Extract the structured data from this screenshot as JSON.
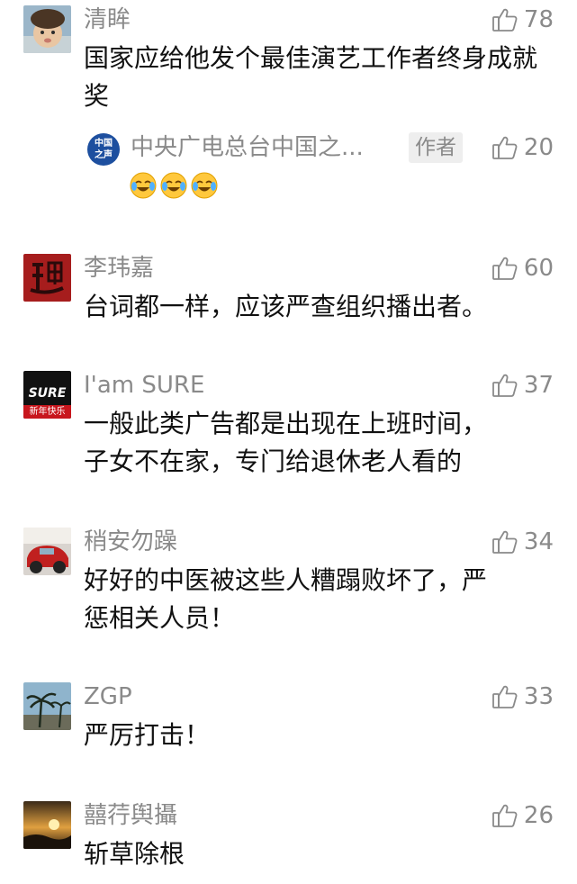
{
  "comments": [
    {
      "nickname": "清眸",
      "likes": "78",
      "text": "国家应给他发个最佳演艺工作者终身成就奖",
      "reply": {
        "avatar_text": "中国\n之声",
        "name": "中央广电总台中国之...",
        "author_tag": "作者",
        "likes": "20",
        "emoji_icon": "laughing-crying-emoji",
        "emoji_count": 3
      }
    },
    {
      "nickname": "李玮嘉",
      "likes": "60",
      "text": "台词都一样，应该严查组织播出者。"
    },
    {
      "nickname": "I'am SURE",
      "likes": "37",
      "text": "一般此类广告都是出现在上班时间，\n子女不在家，专门给退休老人看的",
      "avatar_text": "SURE",
      "avatar_subtext": "新年快乐"
    },
    {
      "nickname": "稍安勿躁",
      "likes": "34",
      "text": "好好的中医被这些人糟蹋败坏了，严\n惩相关人员！"
    },
    {
      "nickname": "ZGP",
      "likes": "33",
      "text": "严厉打击！"
    },
    {
      "nickname": "囍荇舆攝",
      "likes": "26",
      "text": "斩草除根"
    }
  ],
  "icons": {
    "like": "thumbs-up-icon"
  },
  "colors": {
    "meta_text": "#8a8a8a",
    "body_text": "#111111",
    "reply_avatar": "#1d4f9f"
  }
}
